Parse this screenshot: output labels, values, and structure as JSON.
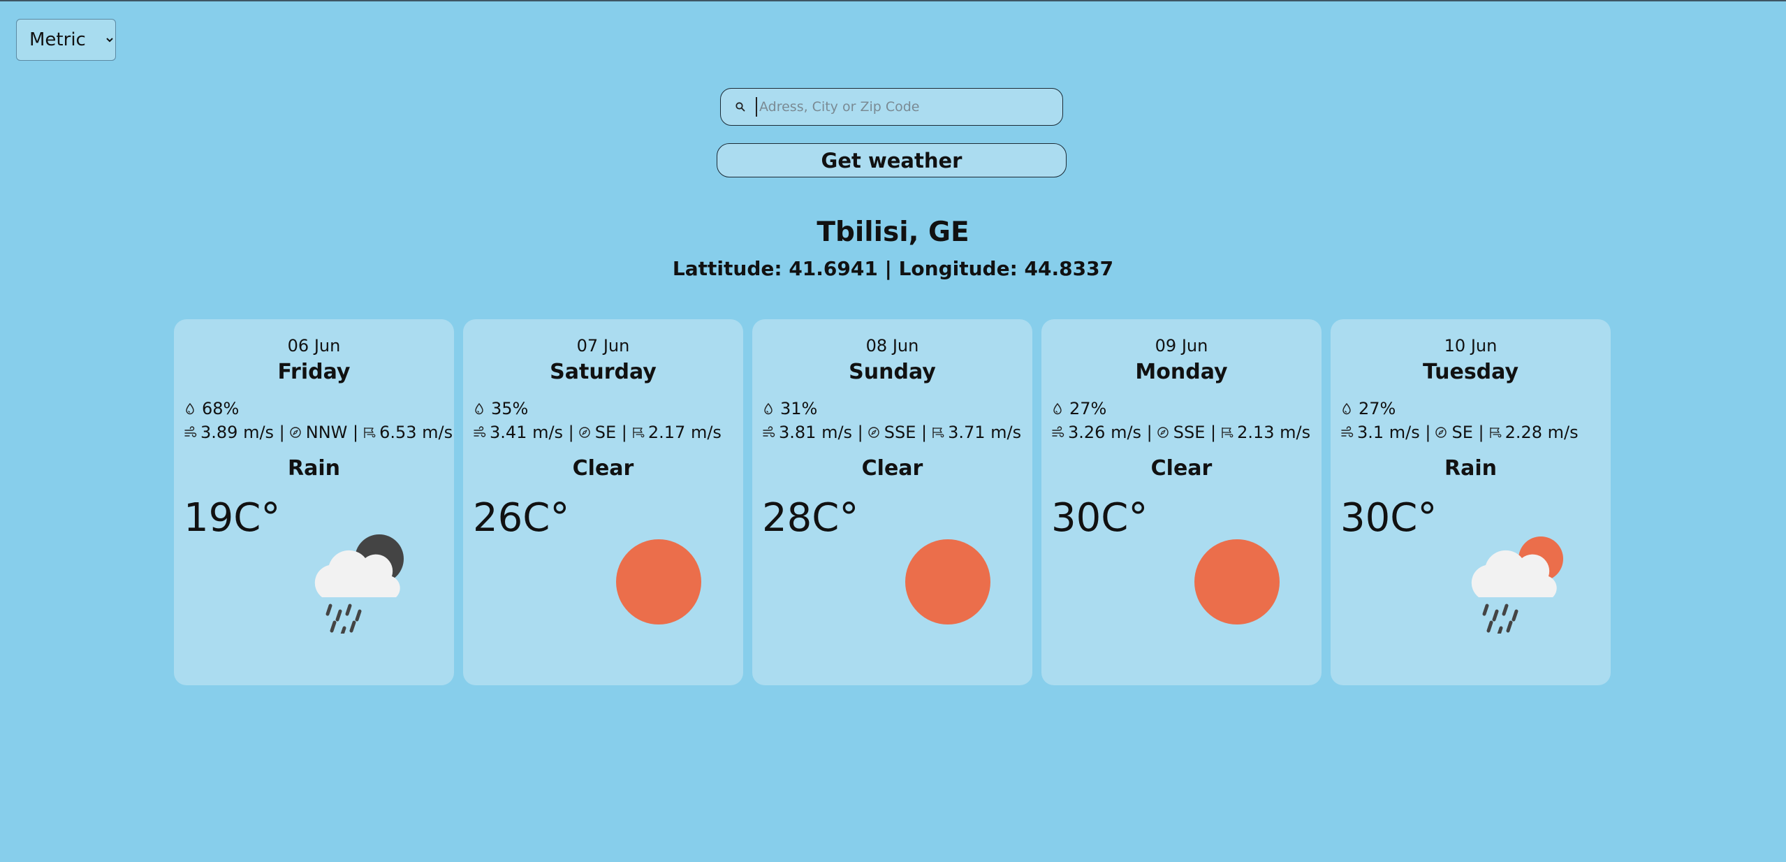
{
  "controls": {
    "units_value": "Metric",
    "units_options": [
      "Metric"
    ],
    "search_placeholder": "Adress, City or Zip Code",
    "search_value": "",
    "get_weather_label": "Get weather"
  },
  "location": {
    "title": "Tbilisi, GE",
    "coords": "Lattitude: 41.6941 | Longitude: 44.8337"
  },
  "colors": {
    "background": "#87ceeb",
    "card": "#abdcf0",
    "sun": "#eb6e4b",
    "cloud": "#f2f2f2",
    "moon": "#444444",
    "rain": "#444444"
  },
  "forecast": [
    {
      "date": "06 Jun",
      "day": "Friday",
      "humidity": "68%",
      "wind_speed": "3.89 m/s |",
      "wind_dir": "NNW |",
      "gust": "6.53 m/s",
      "condition": "Rain",
      "temp": "19C°",
      "icon": "rain-moon-icon"
    },
    {
      "date": "07 Jun",
      "day": "Saturday",
      "humidity": "35%",
      "wind_speed": "3.41 m/s |",
      "wind_dir": "SE |",
      "gust": "2.17 m/s",
      "condition": "Clear",
      "temp": "26C°",
      "icon": "sun-icon"
    },
    {
      "date": "08 Jun",
      "day": "Sunday",
      "humidity": "31%",
      "wind_speed": "3.81 m/s |",
      "wind_dir": "SSE |",
      "gust": "3.71 m/s",
      "condition": "Clear",
      "temp": "28C°",
      "icon": "sun-icon"
    },
    {
      "date": "09 Jun",
      "day": "Monday",
      "humidity": "27%",
      "wind_speed": "3.26 m/s |",
      "wind_dir": "SSE |",
      "gust": "2.13 m/s",
      "condition": "Clear",
      "temp": "30C°",
      "icon": "sun-icon"
    },
    {
      "date": "10 Jun",
      "day": "Tuesday",
      "humidity": "27%",
      "wind_speed": "3.1 m/s |",
      "wind_dir": "SE |",
      "gust": "2.28 m/s",
      "condition": "Rain",
      "temp": "30C°",
      "icon": "rain-sun-icon"
    }
  ]
}
